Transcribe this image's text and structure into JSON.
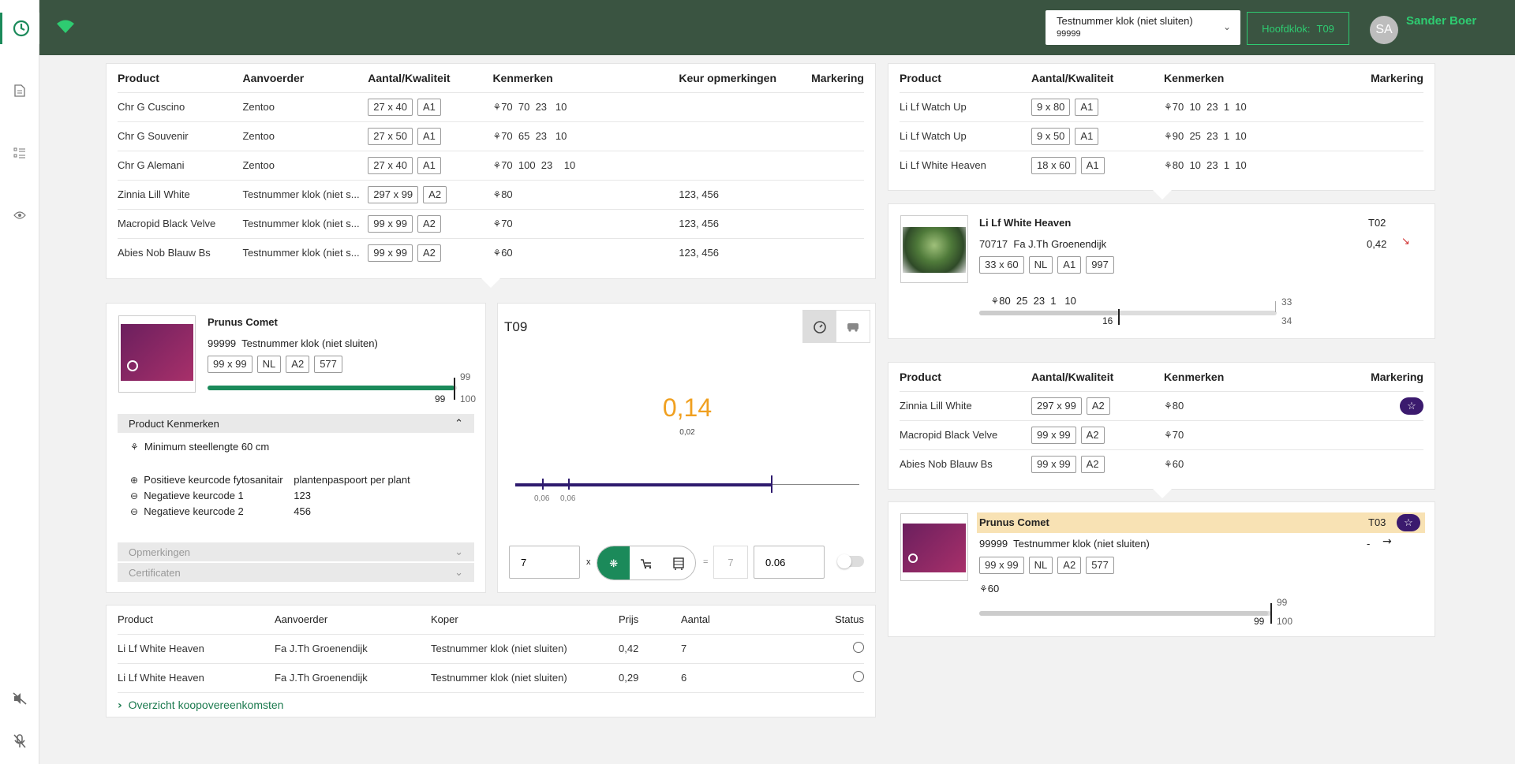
{
  "header": {
    "clock_select_line1": "Testnummer klok (niet sluiten)",
    "clock_select_line2": "99999",
    "hoofdklok_label": "Hoofdklok:",
    "hoofdklok_value": "T09",
    "avatar_initials": "SA",
    "user_name": "Sander Boer"
  },
  "left_table": {
    "columns": [
      "Product",
      "Aanvoerder",
      "Aantal/Kwaliteit",
      "Kenmerken",
      "Keur opmerkingen",
      "Markering"
    ],
    "rows": [
      {
        "product": "Chr G Cuscino",
        "supplier": "Zentoo",
        "size": "27 x 40",
        "quality": "A1",
        "features": "70  70  23   10",
        "remarks": ""
      },
      {
        "product": "Chr G Souvenir",
        "supplier": "Zentoo",
        "size": "27 x 50",
        "quality": "A1",
        "features": "70  65  23   10",
        "remarks": ""
      },
      {
        "product": "Chr G Alemani",
        "supplier": "Zentoo",
        "size": "27 x 40",
        "quality": "A1",
        "features": "70  100  23    10",
        "remarks": ""
      },
      {
        "product": "Zinnia Lill White",
        "supplier": "Testnummer klok (niet s...",
        "size": "297 x 99",
        "quality": "A2",
        "features": "80",
        "remarks": "123, 456"
      },
      {
        "product": "Macropid Black Velve",
        "supplier": "Testnummer klok (niet s...",
        "size": "99 x 99",
        "quality": "A2",
        "features": "70",
        "remarks": "123, 456"
      },
      {
        "product": "Abies Nob Blauw Bs",
        "supplier": "Testnummer klok (niet s...",
        "size": "99 x 99",
        "quality": "A2",
        "features": "60",
        "remarks": "123, 456"
      }
    ]
  },
  "product_card": {
    "name": "Prunus Comet",
    "supplier_id": "99999",
    "supplier": "Testnummer klok (niet sluiten)",
    "chips": [
      "99 x 99",
      "NL",
      "A2",
      "577"
    ],
    "progress_top": "99",
    "progress_left": "99",
    "progress_right": "100",
    "progress_fraction": 0.99,
    "kenmerken_title": "Product Kenmerken",
    "min_stem": "Minimum steellengte 60 cm",
    "keur_rows": [
      {
        "label": "Positieve keurcode fytosanitair",
        "value": "plantenpaspoort per plant"
      },
      {
        "label": "Negatieve keurcode 1",
        "value": "123"
      },
      {
        "label": "Negatieve keurcode 2",
        "value": "456"
      }
    ],
    "opmerkingen": "Opmerkingen",
    "certificaten": "Certificaten"
  },
  "clock_panel": {
    "title": "T09",
    "price": "0,14",
    "min_price": "0,02",
    "tick1": "0,06",
    "tick2": "0,06",
    "qty_value": "7",
    "times": "x",
    "equals": "=",
    "result_qty": "7",
    "price_input": "0.06"
  },
  "sales_table": {
    "columns": [
      "Product",
      "Aanvoerder",
      "Koper",
      "Prijs",
      "Aantal",
      "Status"
    ],
    "rows": [
      {
        "product": "Li Lf White Heaven",
        "supplier": "Fa J.Th Groenendijk",
        "buyer": "Testnummer klok (niet sluiten)",
        "price": "0,42",
        "qty": "7"
      },
      {
        "product": "Li Lf White Heaven",
        "supplier": "Fa J.Th Groenendijk",
        "buyer": "Testnummer klok (niet sluiten)",
        "price": "0,29",
        "qty": "6"
      }
    ],
    "overview_link": "Overzicht koopovereenkomsten"
  },
  "right_table_top": {
    "columns": [
      "Product",
      "Aantal/Kwaliteit",
      "Kenmerken",
      "Markering"
    ],
    "rows": [
      {
        "product": "Li Lf Watch Up",
        "size": "9 x 80",
        "quality": "A1",
        "features": "70  10  23  1  10"
      },
      {
        "product": "Li Lf Watch Up",
        "size": "9 x 50",
        "quality": "A1",
        "features": "90  25  23  1  10"
      },
      {
        "product": "Li Lf White Heaven",
        "size": "18 x 60",
        "quality": "A1",
        "features": "80  10  23  1  10"
      }
    ]
  },
  "right_card_top": {
    "name": "Li Lf White Heaven",
    "clock": "T02",
    "supplier_id": "70717",
    "supplier": "Fa J.Th Groenendijk",
    "price": "0,42",
    "chips": [
      "33 x 60",
      "NL",
      "A1",
      "997"
    ],
    "features": "80  25  23  1   10",
    "bar_top": "33",
    "bar_left": "16",
    "bar_right": "34",
    "bar_fraction": 0.47
  },
  "right_table_bottom": {
    "columns": [
      "Product",
      "Aantal/Kwaliteit",
      "Kenmerken",
      "Markering"
    ],
    "rows": [
      {
        "product": "Zinnia Lill White",
        "size": "297 x 99",
        "quality": "A2",
        "features": "80"
      },
      {
        "product": "Macropid Black Velve",
        "size": "99 x 99",
        "quality": "A2",
        "features": "70"
      },
      {
        "product": "Abies Nob Blauw Bs",
        "size": "99 x 99",
        "quality": "A2",
        "features": "60"
      }
    ]
  },
  "right_card_bottom": {
    "name": "Prunus Comet",
    "clock": "T03",
    "supplier_id": "99999",
    "supplier": "Testnummer klok (niet sluiten)",
    "price": "-",
    "chips": [
      "99 x 99",
      "NL",
      "A2",
      "577"
    ],
    "features": "60",
    "bar_top": "99",
    "bar_left": "99",
    "bar_right": "100",
    "bar_fraction": 0.99
  },
  "colors": {
    "header": "#3a5441",
    "accent": "#1b8a5a",
    "price": "#f0a020",
    "purple": "#3b1a6e"
  }
}
